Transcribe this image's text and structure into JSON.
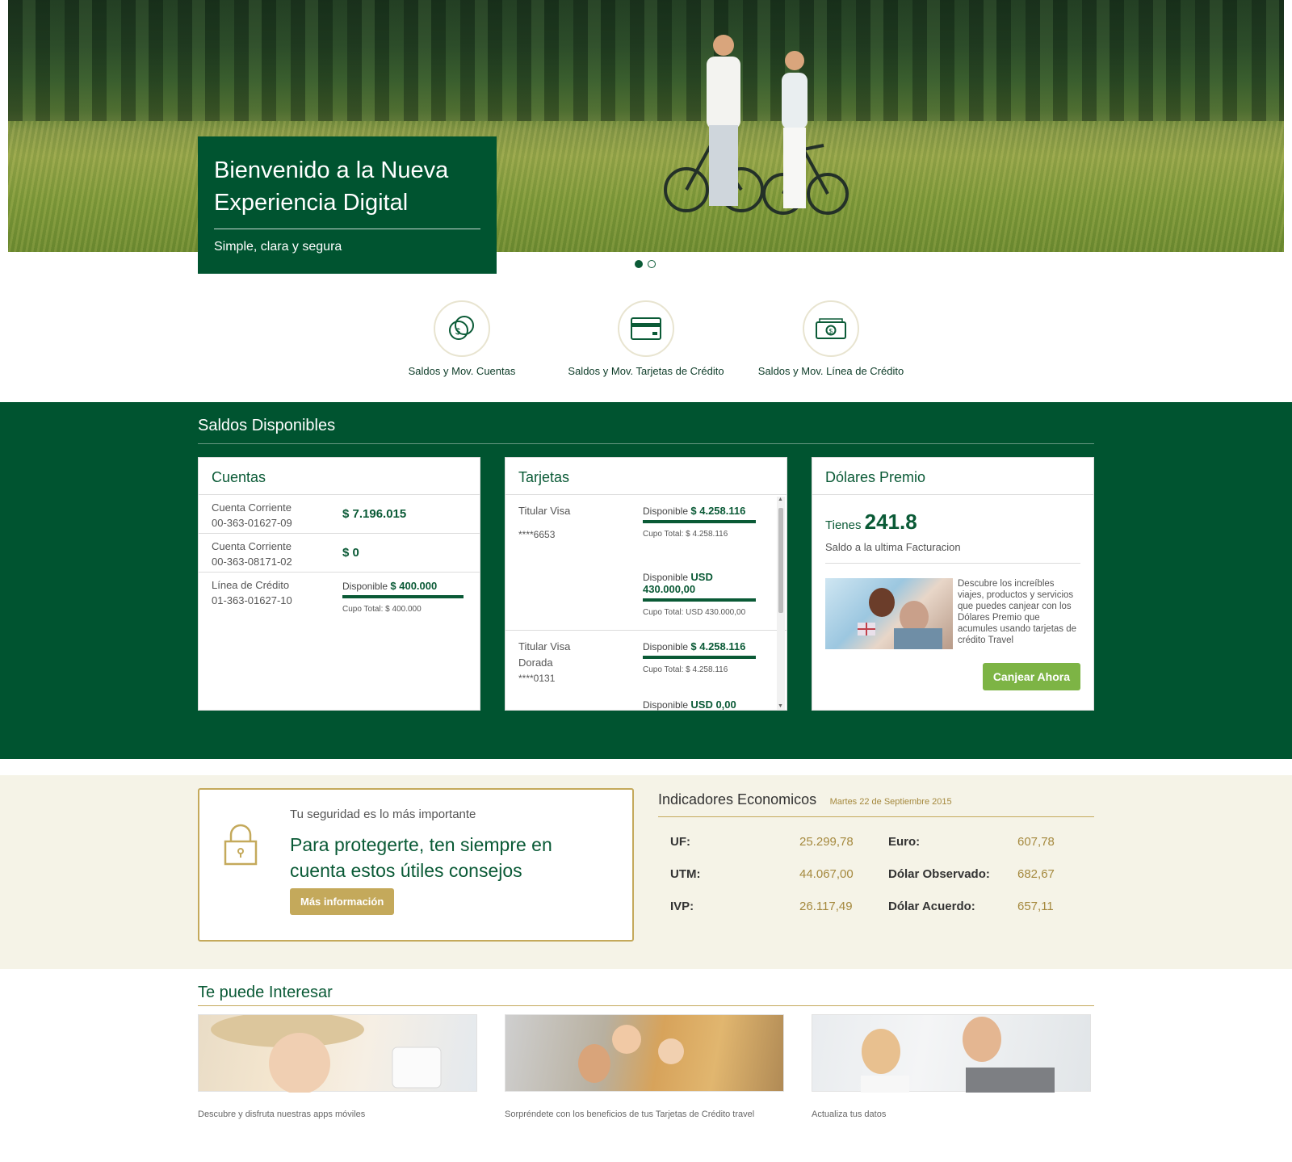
{
  "hero": {
    "title": "Bienvenido a la Nueva Experiencia Digital",
    "subtitle": "Simple, clara y segura"
  },
  "quick_access": [
    {
      "label": "Saldos y Mov. Cuentas",
      "icon": "coins-icon"
    },
    {
      "label": "Saldos y Mov. Tarjetas de Crédito",
      "icon": "credit-card-icon"
    },
    {
      "label": "Saldos y Mov. Línea de Crédito",
      "icon": "cash-icon"
    }
  ],
  "saldos": {
    "title": "Saldos Disponibles",
    "cuentas": {
      "title": "Cuentas",
      "rows": [
        {
          "type": "Cuenta Corriente",
          "number": "00-363-01627-09",
          "amount": "$ 7.196.015"
        },
        {
          "type": "Cuenta Corriente",
          "number": "00-363-08171-02",
          "amount": "$ 0"
        }
      ],
      "credit": {
        "type": "Línea de Crédito",
        "number": "01-363-01627-10",
        "available_label": "Disponible",
        "available": "$ 400.000",
        "cupo": "Cupo Total: $ 400.000"
      }
    },
    "tarjetas": {
      "title": "Tarjetas",
      "items": [
        {
          "name": "Titular Visa",
          "number": "****6653",
          "available_label": "Disponible",
          "available": "$ 4.258.116",
          "cupo": "Cupo Total: $ 4.258.116",
          "usd_label": "Disponible",
          "usd": "USD 430.000,00",
          "usd_cupo": "Cupo Total: USD 430.000,00"
        },
        {
          "name": "Titular Visa Dorada",
          "number": "****0131",
          "available_label": "Disponible",
          "available": "$ 4.258.116",
          "cupo": "Cupo Total: $ 4.258.116",
          "usd_label": "Disponible",
          "usd": "USD 0,00"
        }
      ]
    },
    "dolares": {
      "title": "Dólares Premio",
      "tienes_label": "Tienes",
      "value": "241.8",
      "sub": "Saldo a la ultima Facturacion",
      "promo": "Descubre los increíbles viajes, productos y servicios que puedes canjear con los Dólares Premio que acumules usando tarjetas de crédito Travel",
      "button": "Canjear Ahora"
    }
  },
  "security": {
    "small": "Tu seguridad es lo más importante",
    "big": "Para protegerte, ten siempre en cuenta estos útiles consejos",
    "button": "Más información"
  },
  "indicadores": {
    "title": "Indicadores Economicos",
    "date": "Martes 22 de Septiembre 2015",
    "rows": [
      {
        "k1": "UF:",
        "v1": "25.299,78",
        "k2": "Euro:",
        "v2": "607,78"
      },
      {
        "k1": "UTM:",
        "v1": "44.067,00",
        "k2": "Dólar Observado:",
        "v2": "682,67"
      },
      {
        "k1": "IVP:",
        "v1": "26.117,49",
        "k2": "Dólar Acuerdo:",
        "v2": "657,11"
      }
    ]
  },
  "interest": {
    "title": "Te puede Interesar",
    "items": [
      {
        "caption": "Descubre y disfruta nuestras apps móviles"
      },
      {
        "caption": "Sorpréndete con los beneficios de tus Tarjetas de Crédito travel"
      },
      {
        "caption": "Actualiza tus datos"
      }
    ]
  },
  "colors": {
    "brand_green": "#005430",
    "accent_gold": "#c4a95b",
    "button_green": "#7db445"
  }
}
